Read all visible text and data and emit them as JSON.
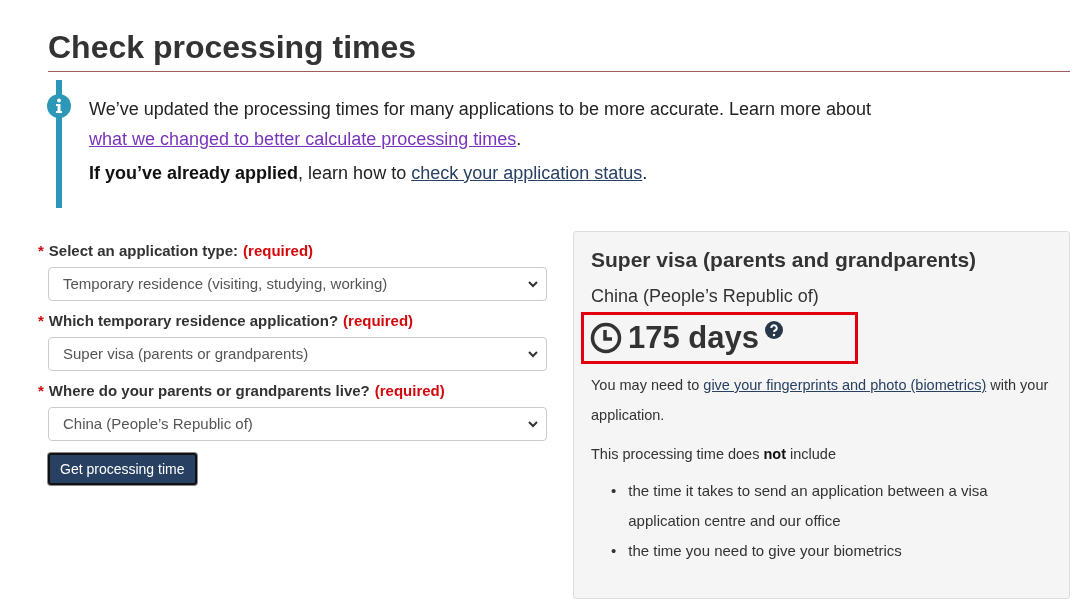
{
  "title": "Check processing times",
  "notice": {
    "paragraphs": [
      [
        {
          "kind": "text",
          "text": "We’ve updated the processing times for many applications to be more accurate. Learn more about "
        },
        {
          "kind": "link",
          "text": "what we changed to better calculate processing times",
          "visited": true
        },
        {
          "kind": "text",
          "text": "."
        }
      ],
      [
        {
          "kind": "bold",
          "text": "If you’ve already applied"
        },
        {
          "kind": "text",
          "text": ", learn how to "
        },
        {
          "kind": "link",
          "text": "check your application status",
          "visited": false
        },
        {
          "kind": "text",
          "text": "."
        }
      ]
    ]
  },
  "form": {
    "fields": [
      {
        "marker": "*",
        "label": "Select an application type:",
        "required": "(required)",
        "value": "Temporary residence (visiting, studying, working)"
      },
      {
        "marker": "*",
        "label": "Which temporary residence application?",
        "required": "(required)",
        "value": "Super visa (parents or grandparents)"
      },
      {
        "marker": "*",
        "label": "Where do your parents or grandparents live?",
        "required": "(required)",
        "value": "China (People’s Republic of)"
      }
    ],
    "button": "Get processing time"
  },
  "result": {
    "heading": "Super visa (parents and grandparents)",
    "country": "China (People’s Republic of)",
    "time": "175 days",
    "highlighted": true,
    "paragraphs": [
      [
        {
          "kind": "text",
          "text": "You may need to "
        },
        {
          "kind": "link",
          "text": "give your fingerprints and photo (biometrics)",
          "visited": false
        },
        {
          "kind": "text",
          "text": " with your application."
        }
      ],
      [
        {
          "kind": "text",
          "text": "This processing time does "
        },
        {
          "kind": "bold",
          "text": "not"
        },
        {
          "kind": "text",
          "text": " include"
        }
      ]
    ],
    "bullets": [
      {
        "marker": "•",
        "text": "the time it takes to send an application between a visa application centre and our office"
      },
      {
        "marker": "•",
        "text": "the time you need to give your biometrics"
      }
    ]
  }
}
